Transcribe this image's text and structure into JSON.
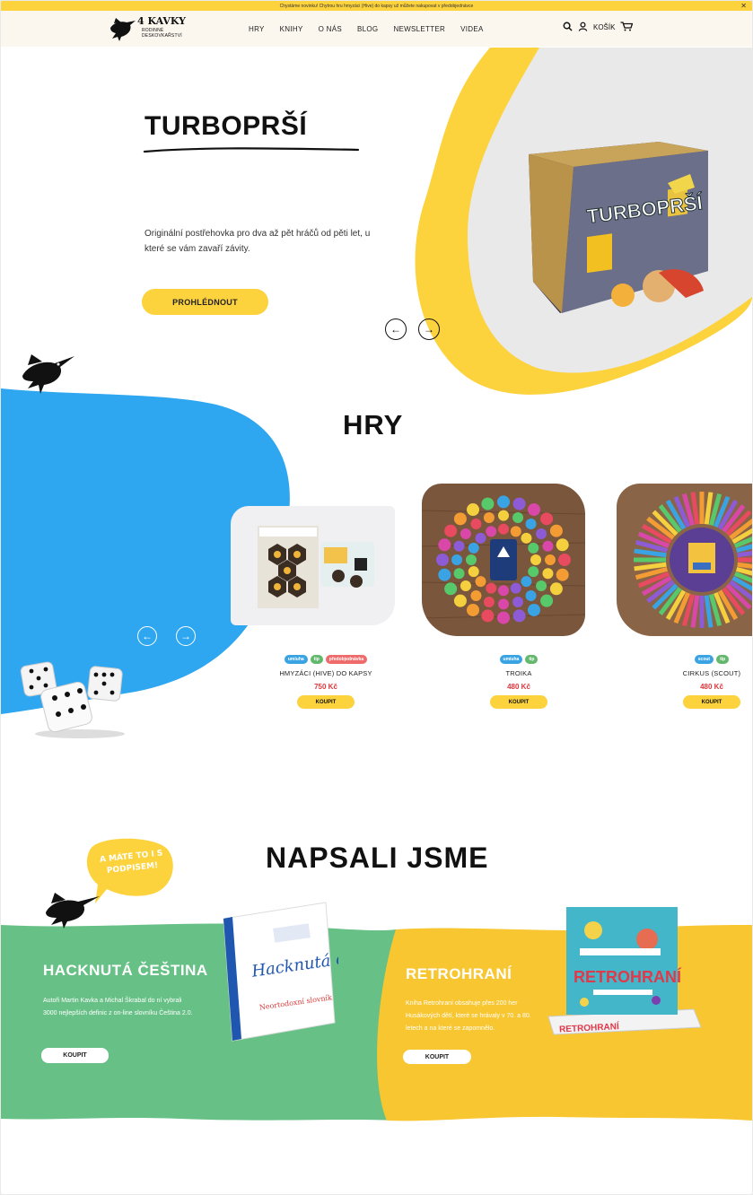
{
  "announcement": {
    "text": "Chystáme novinku! Chytrou hru hmyzáci (Hive) do kapsy už můžete nakupovat v předobjednávce",
    "close_label": "✕"
  },
  "brand": {
    "logo_name": "4 KAVKY",
    "logo_sub": "RODINNÉ DESKOVKAŘSTVÍ"
  },
  "nav": {
    "items": [
      "HRY",
      "KNIHY",
      "O NÁS",
      "BLOG",
      "NEWSLETTER",
      "VIDEA"
    ]
  },
  "header_icons": {
    "cart_label": "KOŠÍK",
    "search_icon": "search-icon",
    "user_icon": "user-icon",
    "cart_icon": "cart-icon"
  },
  "hero": {
    "title": "TURBOPRŠÍ",
    "description": "Originální postřehovka pro dva až pět hráčů od pěti let, u které se vám zavaří závity.",
    "button_label": "PROHLÉDNOUT",
    "box_title": "TURBOPRŠÍ",
    "prev_label": "←",
    "next_label": "→"
  },
  "games": {
    "title": "HRY",
    "prev_label": "←",
    "next_label": "→",
    "products": [
      {
        "name": "HMYZÁCI (HIVE) DO KAPSY",
        "price": "750 Kč",
        "buy_label": "KOUPIT",
        "tags": [
          "umíuha",
          "tip",
          "předobjednávka"
        ]
      },
      {
        "name": "TROIKA",
        "price": "480 Kč",
        "buy_label": "KOUPIT",
        "tags": [
          "umíuha",
          "tip"
        ]
      },
      {
        "name": "CIRKUS (SCOUT)",
        "price": "480 Kč",
        "buy_label": "KOUPIT",
        "tags": [
          "scout",
          "tip"
        ]
      }
    ]
  },
  "books_section": {
    "title": "NAPSALI JSME",
    "bubble": "A MÁTE TO I S PODPISEM!",
    "books": [
      {
        "title": "HACKNUTÁ ČEŠTINA",
        "description": "Autoři Martin Kavka a Michal Škrabal do ní vybrali 3000 nejlepších definic z on-line slovníku Čeština 2.0.",
        "buy_label": "KOUPIT",
        "cover_title": "Hacknutá čeština",
        "cover_sub": "Neortodoxní slovník"
      },
      {
        "title": "RETROHRANÍ",
        "description": "Kniha Retrohraní obsahuje přes 200 her Husákových dětí, které se hrávaly v 70. a 80. letech a na které se zapomnělo.",
        "buy_label": "KOUPIT",
        "cover_title": "RETROHRANÍ"
      }
    ]
  },
  "colors": {
    "yellow": "#fcd23d",
    "blue": "#2ea7f0",
    "green": "#67c086",
    "price_red": "#e3353a"
  }
}
